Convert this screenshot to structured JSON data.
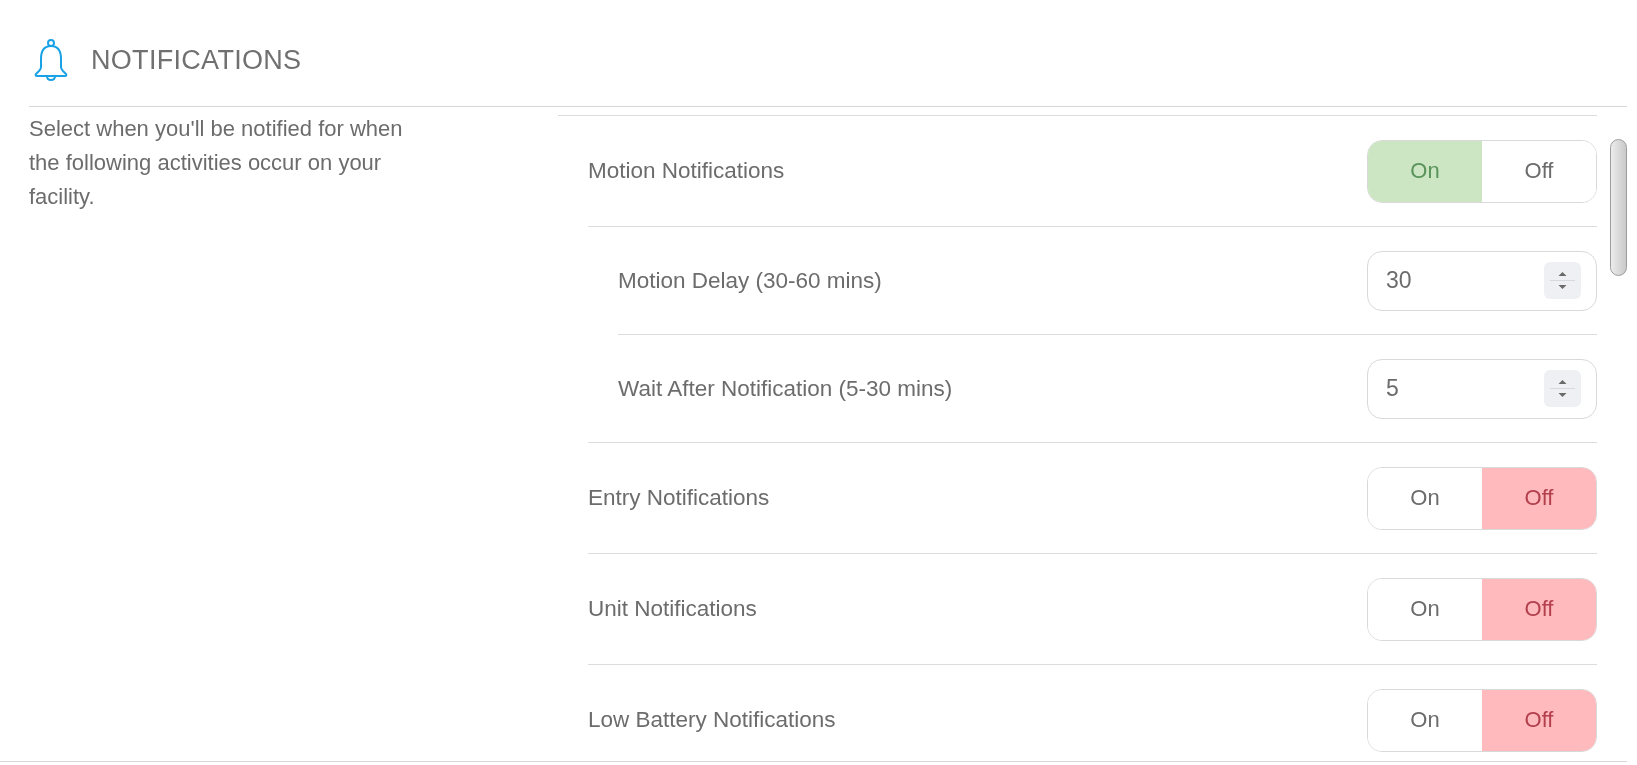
{
  "header": {
    "title": "NOTIFICATIONS"
  },
  "description": "Select when you'll be notified for when the following activities occur on your facility.",
  "settings": [
    {
      "kind": "toggle",
      "label": "Motion Notifications",
      "options": [
        {
          "label": "On",
          "selected": true
        },
        {
          "label": "Off",
          "selected": false
        }
      ],
      "children": [
        {
          "kind": "number",
          "label": "Motion Delay (30-60 mins)",
          "value": "30"
        },
        {
          "kind": "number",
          "label": "Wait After Notification (5-30 mins)",
          "value": "5"
        }
      ]
    },
    {
      "kind": "toggle",
      "label": "Entry Notifications",
      "options": [
        {
          "label": "On",
          "selected": false
        },
        {
          "label": "Off",
          "selected": true
        }
      ]
    },
    {
      "kind": "toggle",
      "label": "Unit Notifications",
      "options": [
        {
          "label": "On",
          "selected": false
        },
        {
          "label": "Off",
          "selected": true
        }
      ]
    },
    {
      "kind": "toggle",
      "label": "Low Battery Notifications",
      "options": [
        {
          "label": "On",
          "selected": false
        },
        {
          "label": "Off",
          "selected": true
        }
      ]
    }
  ]
}
